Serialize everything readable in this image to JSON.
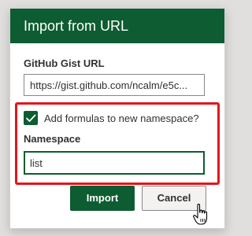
{
  "dialog": {
    "title": "Import from URL",
    "gist_label": "GitHub Gist URL",
    "gist_url_value": "https://gist.github.com/ncalm/e5c...",
    "checkbox_label": "Add formulas to new namespace?",
    "checkbox_checked": true,
    "namespace_label": "Namespace",
    "namespace_value": "list",
    "import_label": "Import",
    "cancel_label": "Cancel"
  },
  "colors": {
    "accent": "#0e5c31",
    "highlight": "#e3151d"
  },
  "icons": {
    "checkbox": "checkmark-icon",
    "cursor": "hand-pointer-icon"
  }
}
